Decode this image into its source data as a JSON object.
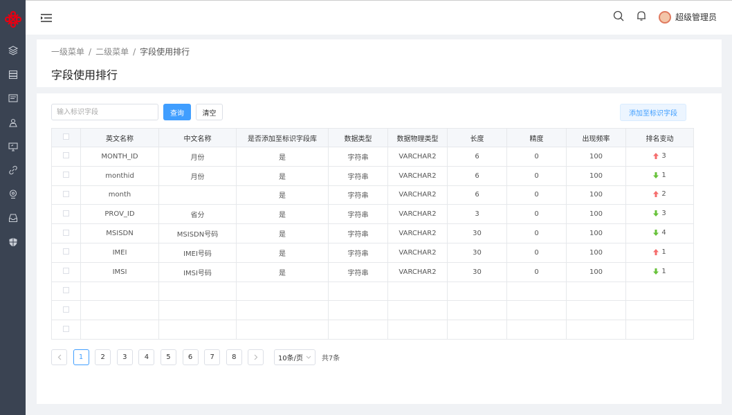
{
  "header": {
    "username": "超级管理员"
  },
  "breadcrumb": [
    "一级菜单",
    "二级菜单",
    "字段使用排行"
  ],
  "page_title": "字段使用排行",
  "toolbar": {
    "search_placeholder": "输入标识字段",
    "query_label": "查询",
    "clear_label": "清空",
    "add_label": "添加至标识字段"
  },
  "table": {
    "columns": [
      "英文名称",
      "中文名称",
      "是否添加至标识字段库",
      "数据类型",
      "数据物理类型",
      "长度",
      "精度",
      "出现频率",
      "排名变动"
    ],
    "rows": [
      {
        "en": "MONTH_ID",
        "cn": "月份",
        "added": "是",
        "type": "字符串",
        "phys": "VARCHAR2",
        "len": "6",
        "prec": "0",
        "freq": "100",
        "dir": "up",
        "change": "3"
      },
      {
        "en": "monthid",
        "cn": "月份",
        "added": "是",
        "type": "字符串",
        "phys": "VARCHAR2",
        "len": "6",
        "prec": "0",
        "freq": "100",
        "dir": "down",
        "change": "1"
      },
      {
        "en": "month",
        "cn": "",
        "added": "是",
        "type": "字符串",
        "phys": "VARCHAR2",
        "len": "6",
        "prec": "0",
        "freq": "100",
        "dir": "up",
        "change": "2"
      },
      {
        "en": "PROV_ID",
        "cn": "省分",
        "added": "是",
        "type": "字符串",
        "phys": "VARCHAR2",
        "len": "3",
        "prec": "0",
        "freq": "100",
        "dir": "down",
        "change": "3"
      },
      {
        "en": "MSISDN",
        "cn": "MSISDN号码",
        "added": "是",
        "type": "字符串",
        "phys": "VARCHAR2",
        "len": "30",
        "prec": "0",
        "freq": "100",
        "dir": "down",
        "change": "4"
      },
      {
        "en": "IMEI",
        "cn": "IMEI号码",
        "added": "是",
        "type": "字符串",
        "phys": "VARCHAR2",
        "len": "30",
        "prec": "0",
        "freq": "100",
        "dir": "up",
        "change": "1"
      },
      {
        "en": "IMSI",
        "cn": "IMSI号码",
        "added": "是",
        "type": "字符串",
        "phys": "VARCHAR2",
        "len": "30",
        "prec": "0",
        "freq": "100",
        "dir": "down",
        "change": "1"
      }
    ]
  },
  "pagination": {
    "pages": [
      "1",
      "2",
      "3",
      "4",
      "5",
      "6",
      "7",
      "8"
    ],
    "current": "1",
    "page_size": "10条/页",
    "total": "共7条"
  },
  "colors": {
    "primary": "#409eff",
    "up": "#f56c6c",
    "down": "#67c23a",
    "sidebar": "#3a4352"
  },
  "icons": {
    "sidebar": [
      "layers-icon",
      "database-icon",
      "document-icon",
      "user-location-icon",
      "monitor-icon",
      "link-icon",
      "location-pin-icon",
      "inbox-icon",
      "shield-icon"
    ]
  }
}
